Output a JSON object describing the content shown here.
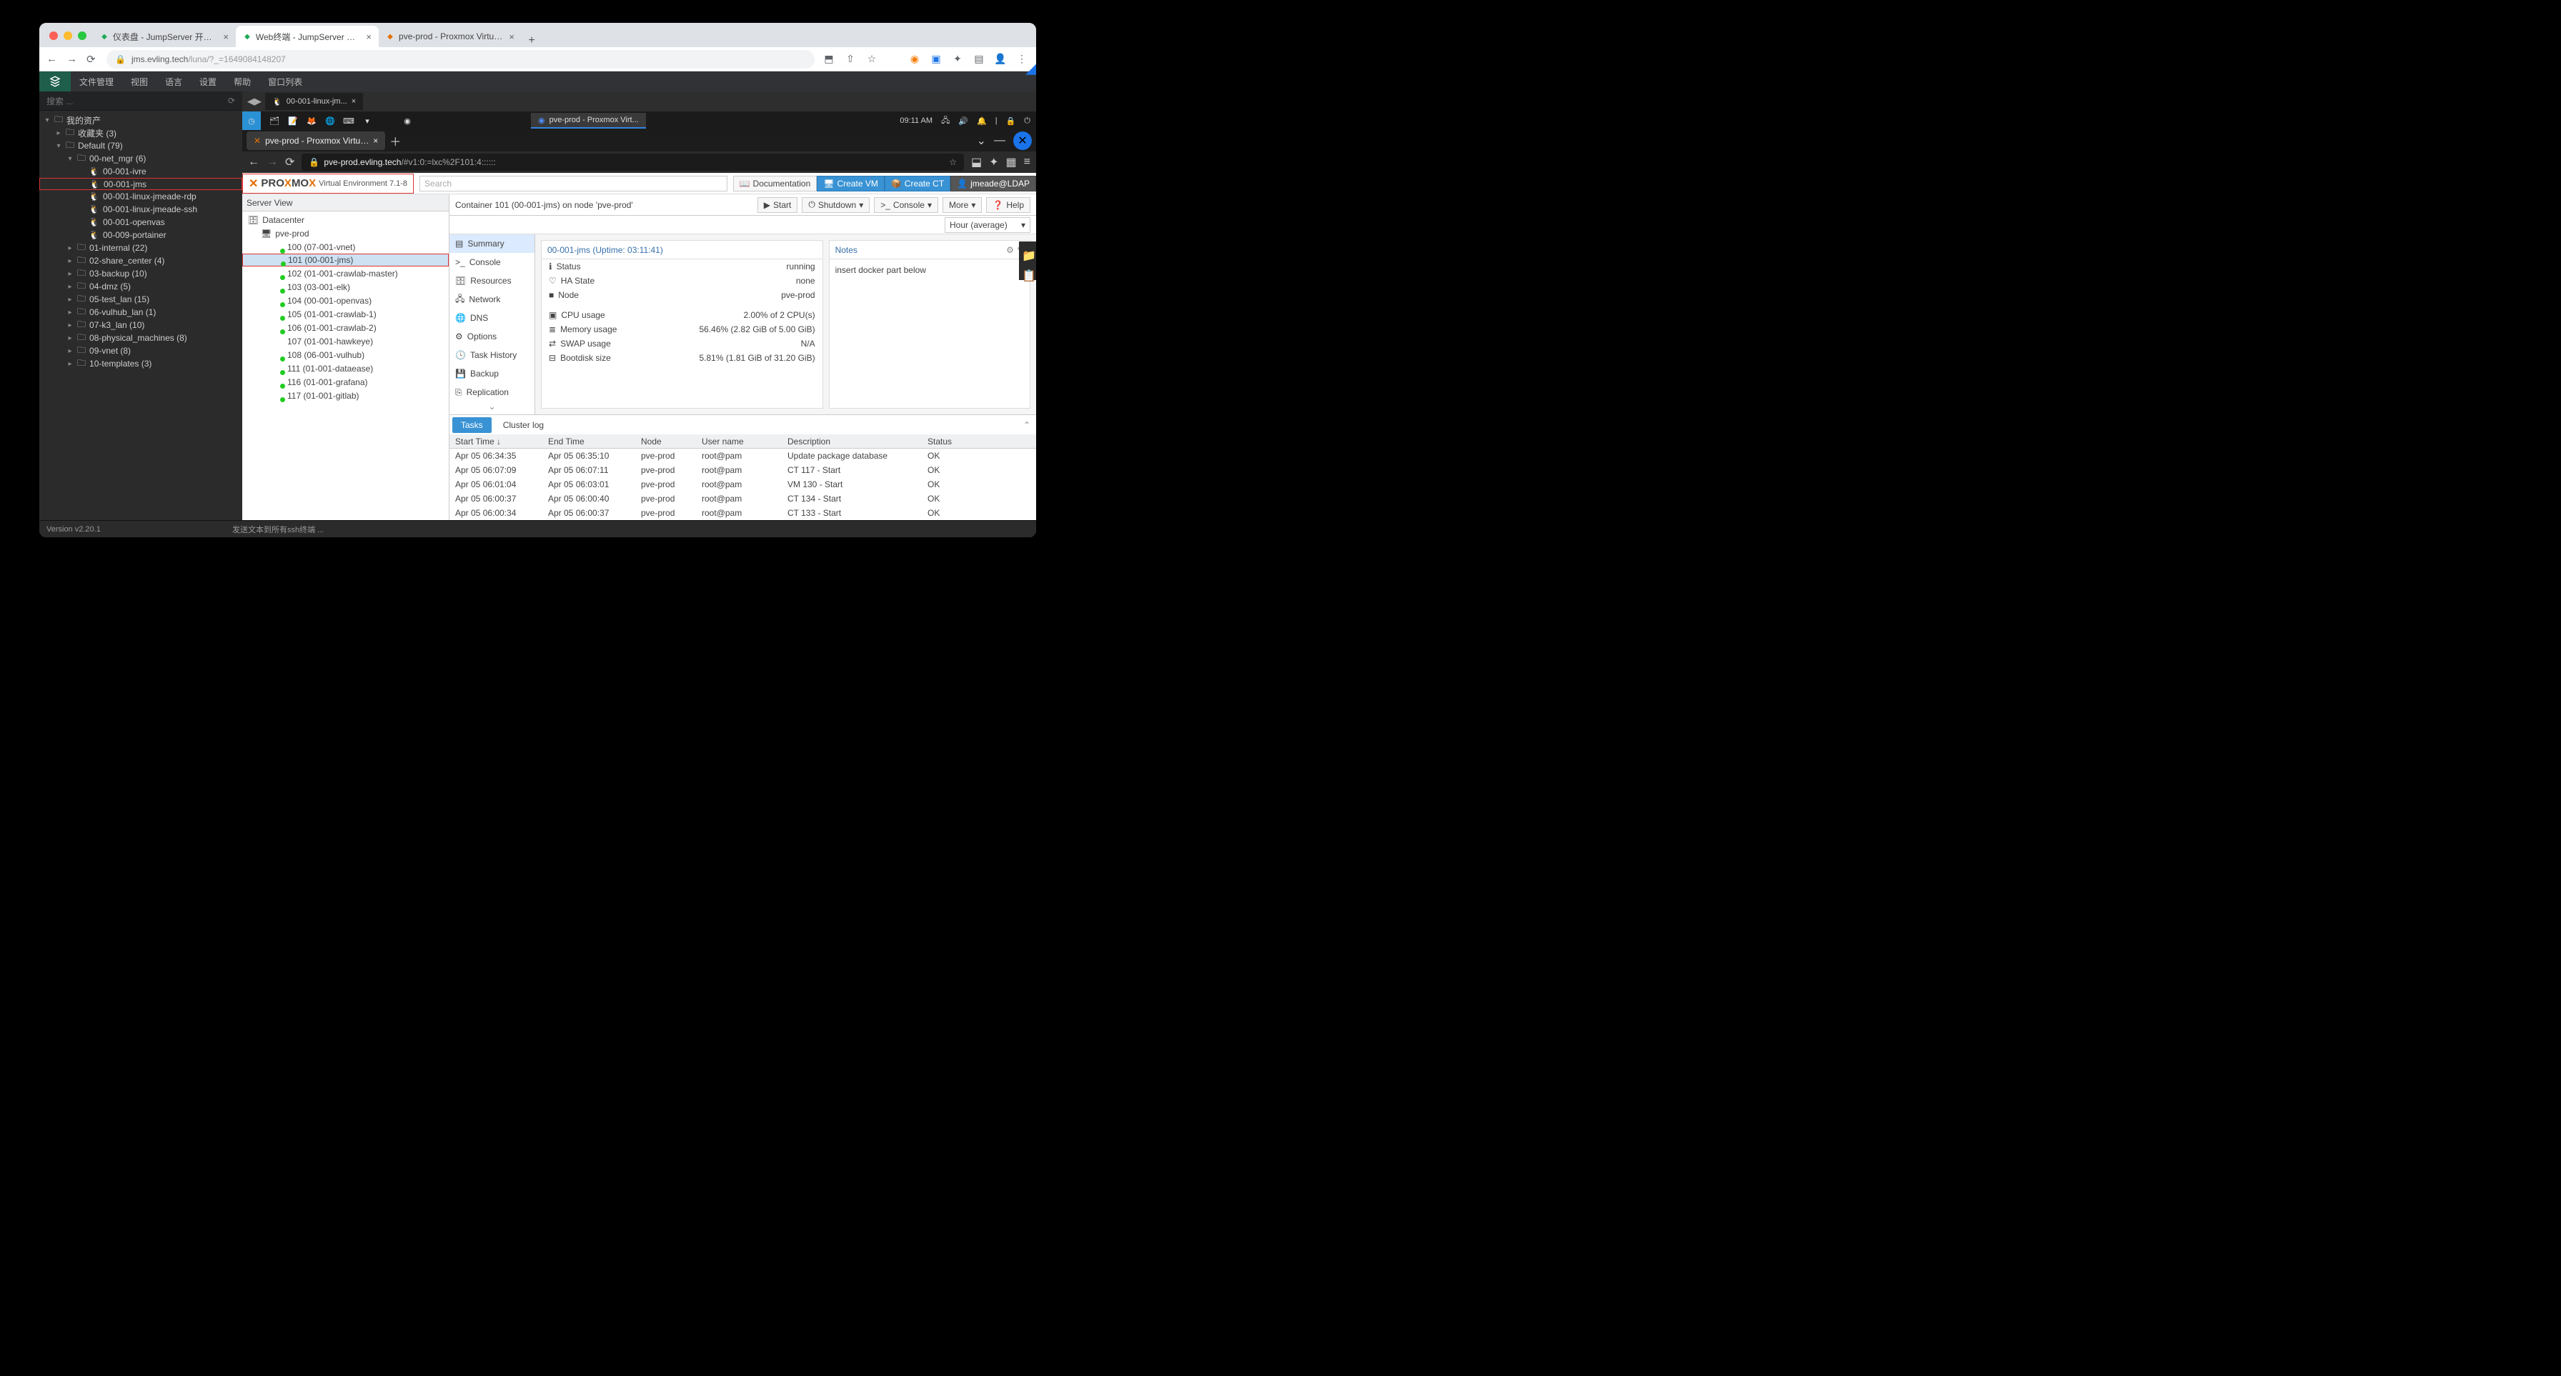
{
  "outer_browser": {
    "tabs": [
      {
        "title": "仪表盘 - JumpServer 开源堡垒…",
        "favicon": "green"
      },
      {
        "title": "Web终端 - JumpServer 开源堡…",
        "favicon": "green",
        "active": true
      },
      {
        "title": "pve-prod - Proxmox Virtual En…",
        "favicon": "orange"
      }
    ],
    "url_host": "jms.evling.tech",
    "url_path": "/luna/?_=1649084148207"
  },
  "luna": {
    "menus": [
      "文件管理",
      "视图",
      "语言",
      "设置",
      "帮助",
      "窗口列表"
    ],
    "search_placeholder": "搜索 ...",
    "tree": [
      {
        "d": 0,
        "exp": "▾",
        "ico": "fold",
        "t": "我的资产"
      },
      {
        "d": 1,
        "exp": "▸",
        "ico": "fold",
        "t": "收藏夹 (3)"
      },
      {
        "d": 1,
        "exp": "▾",
        "ico": "fold",
        "t": "Default (79)"
      },
      {
        "d": 2,
        "exp": "▾",
        "ico": "fold",
        "t": "00-net_mgr (6)"
      },
      {
        "d": 3,
        "exp": "",
        "ico": "lin",
        "t": "00-001-ivre"
      },
      {
        "d": 3,
        "exp": "",
        "ico": "lin",
        "t": "00-001-jms",
        "hl": true
      },
      {
        "d": 3,
        "exp": "",
        "ico": "lin",
        "t": "00-001-linux-jmeade-rdp"
      },
      {
        "d": 3,
        "exp": "",
        "ico": "lin",
        "t": "00-001-linux-jmeade-ssh"
      },
      {
        "d": 3,
        "exp": "",
        "ico": "lin",
        "t": "00-001-openvas"
      },
      {
        "d": 3,
        "exp": "",
        "ico": "lin",
        "t": "00-009-portainer"
      },
      {
        "d": 2,
        "exp": "▸",
        "ico": "fold",
        "t": "01-internal (22)"
      },
      {
        "d": 2,
        "exp": "▸",
        "ico": "fold",
        "t": "02-share_center (4)"
      },
      {
        "d": 2,
        "exp": "▸",
        "ico": "fold",
        "t": "03-backup (10)"
      },
      {
        "d": 2,
        "exp": "▸",
        "ico": "fold",
        "t": "04-dmz (5)"
      },
      {
        "d": 2,
        "exp": "▸",
        "ico": "fold",
        "t": "05-test_lan (15)"
      },
      {
        "d": 2,
        "exp": "▸",
        "ico": "fold",
        "t": "06-vulhub_lan (1)"
      },
      {
        "d": 2,
        "exp": "▸",
        "ico": "fold",
        "t": "07-k3_lan (10)"
      },
      {
        "d": 2,
        "exp": "▸",
        "ico": "fold",
        "t": "08-physical_machines (8)"
      },
      {
        "d": 2,
        "exp": "▸",
        "ico": "fold",
        "t": "09-vnet (8)"
      },
      {
        "d": 2,
        "exp": "▸",
        "ico": "fold",
        "t": "10-templates (3)"
      }
    ],
    "session_tab": "00-001-linux-jm...",
    "version": "Version v2.20.1",
    "footer_hint": "发送文本到所有ssh终端 ..."
  },
  "desktop": {
    "clock": "09:11 AM",
    "active_window": "pve-prod - Proxmox Virt..."
  },
  "firefox": {
    "tab": "pve-prod - Proxmox Virtu…",
    "url_host": "pve-prod.evling.tech",
    "url_frag": "/#v1:0:=lxc%2F101:4::::::"
  },
  "pve": {
    "logo_ver": "Virtual Environment 7.1-8",
    "search": "Search",
    "btn_doc": "Documentation",
    "btn_vm": "Create VM",
    "btn_ct": "Create CT",
    "user": "jmeade@LDAP",
    "server_view": "Server View",
    "tree": [
      {
        "d": 0,
        "ico": "dc",
        "t": "Datacenter"
      },
      {
        "d": 1,
        "ico": "node",
        "t": "pve-prod"
      },
      {
        "d": 2,
        "ico": "ct",
        "t": "100 (07-001-vnet)"
      },
      {
        "d": 2,
        "ico": "ct",
        "t": "101 (00-001-jms)",
        "sel": true
      },
      {
        "d": 2,
        "ico": "ct",
        "t": "102 (01-001-crawlab-master)"
      },
      {
        "d": 2,
        "ico": "ct",
        "t": "103 (03-001-elk)"
      },
      {
        "d": 2,
        "ico": "ct",
        "t": "104 (00-001-openvas)"
      },
      {
        "d": 2,
        "ico": "ct",
        "t": "105 (01-001-crawlab-1)"
      },
      {
        "d": 2,
        "ico": "ct",
        "t": "106 (01-001-crawlab-2)"
      },
      {
        "d": 2,
        "ico": "cto",
        "t": "107 (01-001-hawkeye)"
      },
      {
        "d": 2,
        "ico": "ct",
        "t": "108 (06-001-vulhub)"
      },
      {
        "d": 2,
        "ico": "ct",
        "t": "111 (01-001-dataease)"
      },
      {
        "d": 2,
        "ico": "ct",
        "t": "116 (01-001-grafana)"
      },
      {
        "d": 2,
        "ico": "ct",
        "t": "117 (01-001-gitlab)"
      }
    ],
    "crumb": "Container 101 (00-001-jms) on node 'pve-prod'",
    "actions": {
      "start": "Start",
      "shutdown": "Shutdown",
      "console": "Console",
      "more": "More",
      "help": "Help"
    },
    "side": [
      "Summary",
      "Console",
      "Resources",
      "Network",
      "DNS",
      "Options",
      "Task History",
      "Backup",
      "Replication"
    ],
    "hour": "Hour (average)",
    "title_card": "00-001-jms (Uptime: 03:11:41)",
    "notes_title": "Notes",
    "notes_body": "insert docker part below",
    "status": [
      {
        "k": "Status",
        "v": "running",
        "ico": "ℹ"
      },
      {
        "k": "HA State",
        "v": "none",
        "ico": "♡"
      },
      {
        "k": "Node",
        "v": "pve-prod",
        "ico": "■"
      }
    ],
    "metrics": [
      {
        "k": "CPU usage",
        "v": "2.00% of 2 CPU(s)",
        "pct": 2,
        "ico": "▣"
      },
      {
        "k": "Memory usage",
        "v": "56.46% (2.82 GiB of 5.00 GiB)",
        "pct": 56.46,
        "ico": "≣"
      },
      {
        "k": "SWAP usage",
        "v": "N/A",
        "pct": 0,
        "ico": "⇄"
      },
      {
        "k": "Bootdisk size",
        "v": "5.81% (1.81 GiB of 31.20 GiB)",
        "pct": 5.81,
        "ico": "⊟"
      }
    ],
    "tabs": {
      "tasks": "Tasks",
      "log": "Cluster log"
    },
    "grid_h": [
      "Start Time ↓",
      "End Time",
      "Node",
      "User name",
      "Description",
      "Status"
    ],
    "grid": [
      [
        "Apr 05 06:34:35",
        "Apr 05 06:35:10",
        "pve-prod",
        "root@pam",
        "Update package database",
        "OK"
      ],
      [
        "Apr 05 06:07:09",
        "Apr 05 06:07:11",
        "pve-prod",
        "root@pam",
        "CT 117 - Start",
        "OK"
      ],
      [
        "Apr 05 06:01:04",
        "Apr 05 06:03:01",
        "pve-prod",
        "root@pam",
        "VM 130 - Start",
        "OK"
      ],
      [
        "Apr 05 06:00:37",
        "Apr 05 06:00:40",
        "pve-prod",
        "root@pam",
        "CT 134 - Start",
        "OK"
      ],
      [
        "Apr 05 06:00:34",
        "Apr 05 06:00:37",
        "pve-prod",
        "root@pam",
        "CT 133 - Start",
        "OK"
      ]
    ]
  }
}
